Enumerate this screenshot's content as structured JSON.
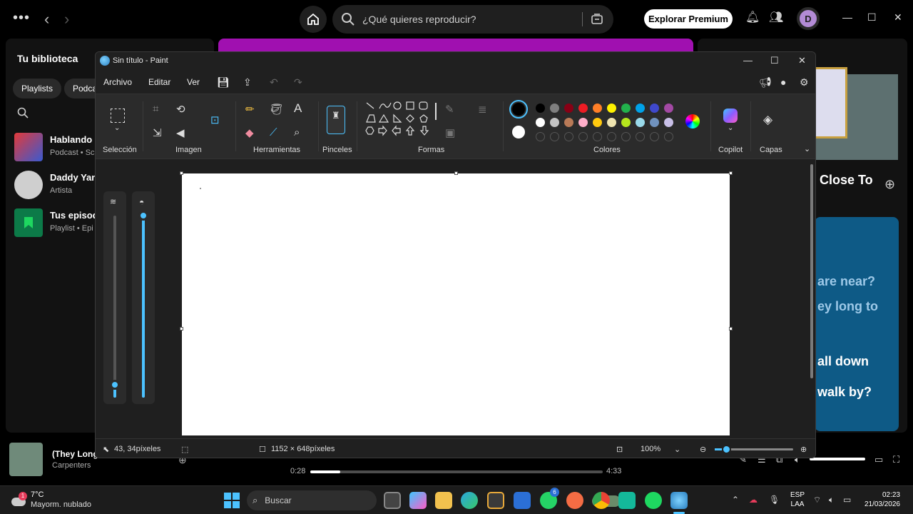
{
  "spotify": {
    "search_placeholder": "¿Qué quieres reproducir?",
    "premium_button": "Explorar Premium",
    "avatar_initial": "D",
    "library_title": "Tu biblioteca",
    "chips": [
      "Playlists",
      "Podca"
    ],
    "library_items": [
      {
        "title": "Hablando I",
        "subtitle": "Podcast • Sc"
      },
      {
        "title": "Daddy Yan",
        "subtitle": "Artista"
      },
      {
        "title": "Tus episod",
        "subtitle": "Playlist • Epi"
      }
    ],
    "now_playing_title": ") Close To",
    "lyrics": [
      "are near?",
      "ey long to",
      "all down",
      "walk by?"
    ],
    "player": {
      "title": "(They Long",
      "artist": "Carpenters",
      "elapsed": "0:28",
      "duration": "4:33",
      "progress": 0.103
    },
    "accent": "#a010b0"
  },
  "paint": {
    "title": "Sin título - Paint",
    "menu": [
      "Archivo",
      "Editar",
      "Ver"
    ],
    "groups": [
      "Selección",
      "Imagen",
      "Herramientas",
      "Pinceles",
      "Formas",
      "Colores",
      "Copilot",
      "Capas"
    ],
    "palette_row1": [
      "#000000",
      "#7f7f7f",
      "#880015",
      "#ed1c24",
      "#ff7f27",
      "#fff200",
      "#22b14c",
      "#00a2e8",
      "#3f48cc",
      "#a349a4"
    ],
    "palette_row2": [
      "#ffffff",
      "#c3c3c3",
      "#b97a57",
      "#ffaec9",
      "#ffc90e",
      "#efe4b0",
      "#b5e61d",
      "#99d9ea",
      "#7092be",
      "#c8bfe7"
    ],
    "primary_color": "#000000",
    "secondary_color": "#ffffff",
    "brush_size_level": 0.07,
    "opacity_level": 1.0,
    "status": {
      "cursor_pos": "43, 34píxeles",
      "canvas_size": "1152 × 648píxeles",
      "zoom": "100%"
    }
  },
  "taskbar": {
    "temperature": "7°C",
    "weather": "Mayorm. nublado",
    "weather_badge": "1",
    "search": "Buscar",
    "whatsapp_badge": "6",
    "lang1": "ESP",
    "lang2": "LAA",
    "time": "02:23",
    "date": "21/03/2026"
  }
}
